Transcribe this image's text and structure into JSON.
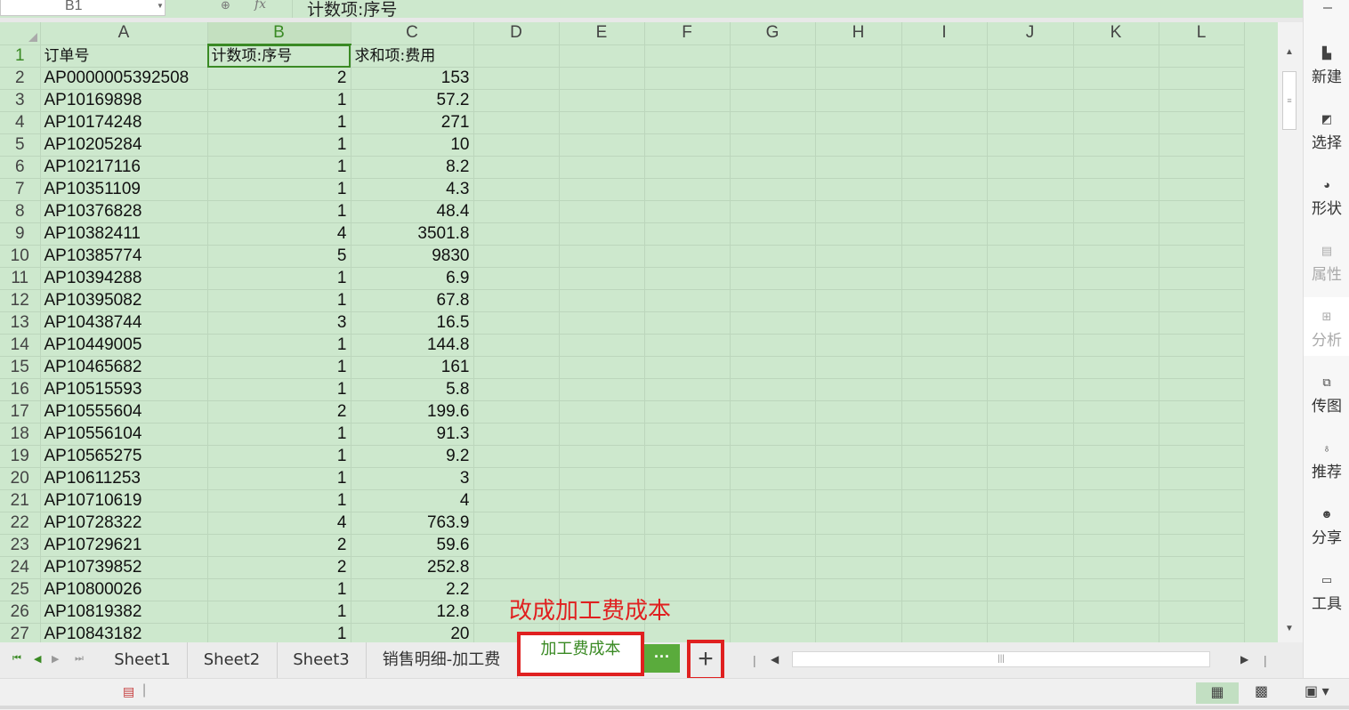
{
  "formula_bar": {
    "name_box": "B1",
    "fx_label": "fx",
    "formula": "计数项:序号"
  },
  "columns": [
    "A",
    "B",
    "C",
    "D",
    "E",
    "F",
    "G",
    "H",
    "I",
    "J",
    "K",
    "L"
  ],
  "rows": [
    {
      "num": "1",
      "a": "订单号",
      "b": "计数项:序号",
      "c": "求和项:费用"
    },
    {
      "num": "2",
      "a": "AP0000005392508",
      "b": "2",
      "c": "153"
    },
    {
      "num": "3",
      "a": "AP10169898",
      "b": "1",
      "c": "57.2"
    },
    {
      "num": "4",
      "a": "AP10174248",
      "b": "1",
      "c": "271"
    },
    {
      "num": "5",
      "a": "AP10205284",
      "b": "1",
      "c": "10"
    },
    {
      "num": "6",
      "a": "AP10217116",
      "b": "1",
      "c": "8.2"
    },
    {
      "num": "7",
      "a": "AP10351109",
      "b": "1",
      "c": "4.3"
    },
    {
      "num": "8",
      "a": "AP10376828",
      "b": "1",
      "c": "48.4"
    },
    {
      "num": "9",
      "a": "AP10382411",
      "b": "4",
      "c": "3501.8"
    },
    {
      "num": "10",
      "a": "AP10385774",
      "b": "5",
      "c": "9830"
    },
    {
      "num": "11",
      "a": "AP10394288",
      "b": "1",
      "c": "6.9"
    },
    {
      "num": "12",
      "a": "AP10395082",
      "b": "1",
      "c": "67.8"
    },
    {
      "num": "13",
      "a": "AP10438744",
      "b": "3",
      "c": "16.5"
    },
    {
      "num": "14",
      "a": "AP10449005",
      "b": "1",
      "c": "144.8"
    },
    {
      "num": "15",
      "a": "AP10465682",
      "b": "1",
      "c": "161"
    },
    {
      "num": "16",
      "a": "AP10515593",
      "b": "1",
      "c": "5.8"
    },
    {
      "num": "17",
      "a": "AP10555604",
      "b": "2",
      "c": "199.6"
    },
    {
      "num": "18",
      "a": "AP10556104",
      "b": "1",
      "c": "91.3"
    },
    {
      "num": "19",
      "a": "AP10565275",
      "b": "1",
      "c": "9.2"
    },
    {
      "num": "20",
      "a": "AP10611253",
      "b": "1",
      "c": "3"
    },
    {
      "num": "21",
      "a": "AP10710619",
      "b": "1",
      "c": "4"
    },
    {
      "num": "22",
      "a": "AP10728322",
      "b": "4",
      "c": "763.9"
    },
    {
      "num": "23",
      "a": "AP10729621",
      "b": "2",
      "c": "59.6"
    },
    {
      "num": "24",
      "a": "AP10739852",
      "b": "2",
      "c": "252.8"
    },
    {
      "num": "25",
      "a": "AP10800026",
      "b": "1",
      "c": "2.2"
    },
    {
      "num": "26",
      "a": "AP10819382",
      "b": "1",
      "c": "12.8"
    },
    {
      "num": "27",
      "a": "AP10843182",
      "b": "1",
      "c": "20"
    }
  ],
  "sheet_tabs": [
    {
      "label": "Sheet1"
    },
    {
      "label": "Sheet2"
    },
    {
      "label": "Sheet3"
    },
    {
      "label": "销售明细-加工费"
    },
    {
      "label": "加工费成本"
    }
  ],
  "tab_more_label": "···",
  "tab_add_label": "+",
  "annotation": "改成加工费成本",
  "right_pane": [
    {
      "label": "新建",
      "icon": "new-file-icon"
    },
    {
      "label": "选择",
      "icon": "select-cursor-icon"
    },
    {
      "label": "形状",
      "icon": "shapes-icon"
    },
    {
      "label": "属性",
      "icon": "properties-icon"
    },
    {
      "label": "分析",
      "icon": "analysis-icon"
    },
    {
      "label": "传图",
      "icon": "image-upload-icon"
    },
    {
      "label": "推荐",
      "icon": "recommend-icon"
    },
    {
      "label": "分享",
      "icon": "share-users-icon"
    },
    {
      "label": "工具",
      "icon": "toolbox-icon"
    }
  ],
  "colors": {
    "grid_bg": "#cde8cd",
    "accent_green": "#3a8a24",
    "annotation_red": "#e02020"
  }
}
